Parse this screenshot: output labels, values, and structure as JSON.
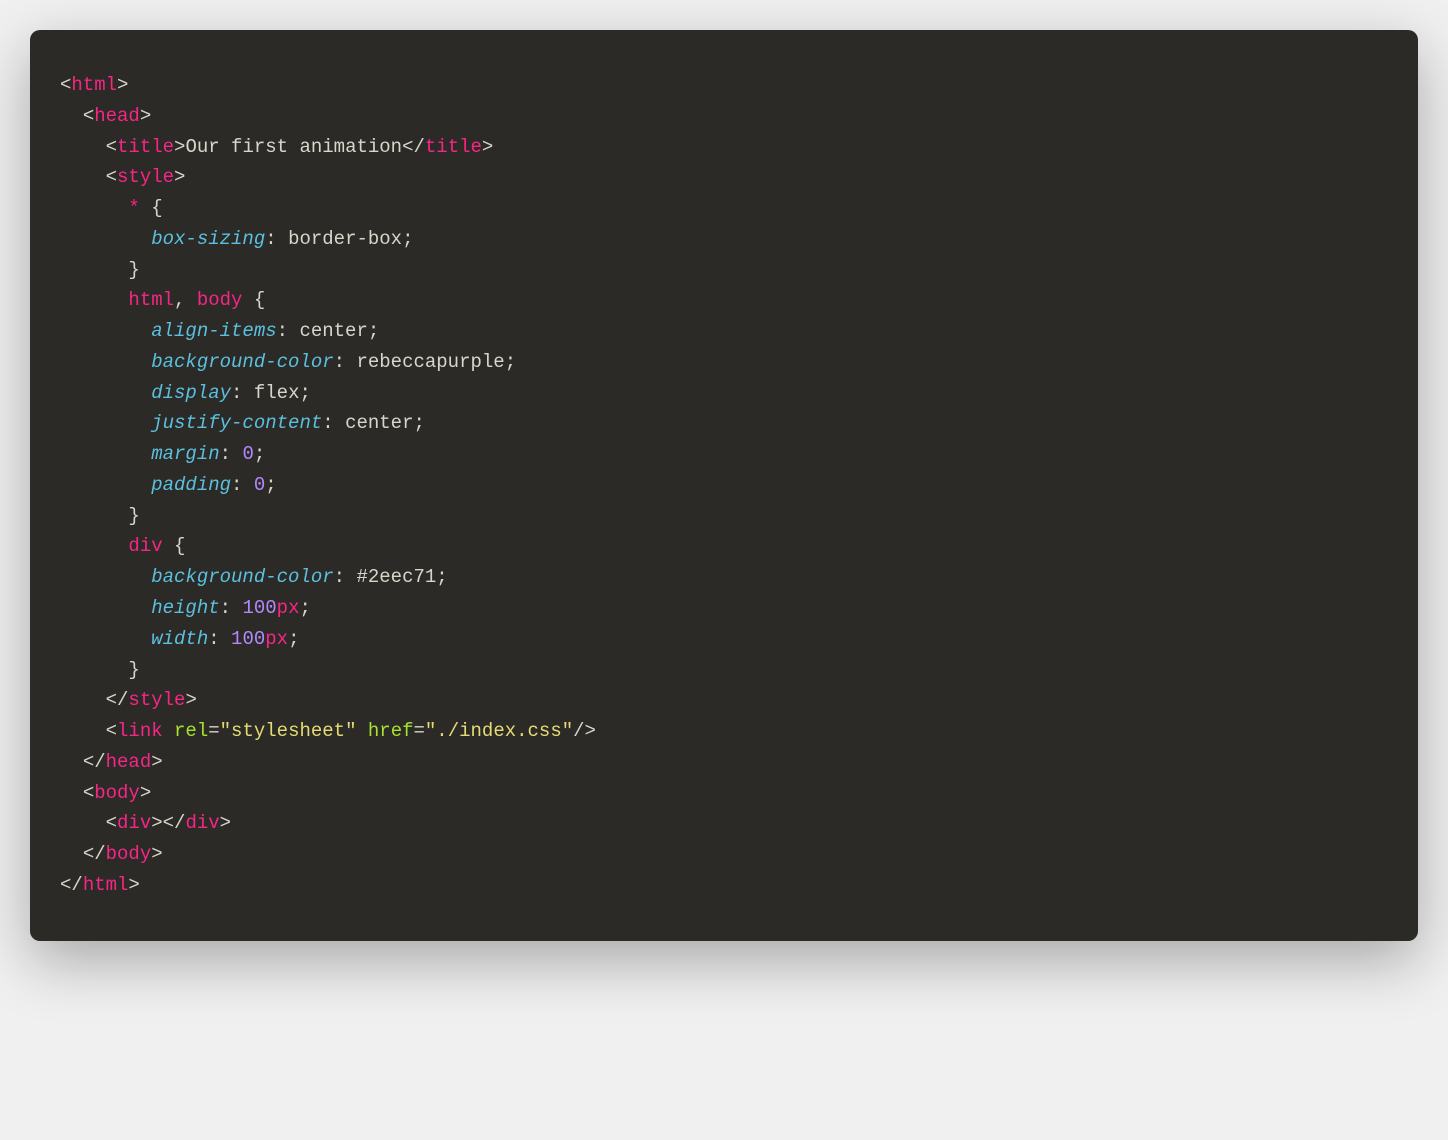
{
  "tokens": {
    "html": "html",
    "head": "head",
    "title": "title",
    "style": "style",
    "link": "link",
    "body": "body",
    "div": "div",
    "titleText": "Our first animation",
    "star": "*",
    "boxSizing": "box-sizing",
    "borderBox": "border-box",
    "htmlSel": "html",
    "bodySel": "body",
    "alignItems": "align-items",
    "center": "center",
    "backgroundColor": "background-color",
    "rebeccapurple": "rebeccapurple",
    "display": "display",
    "flex": "flex",
    "justifyContent": "justify-content",
    "margin": "margin",
    "zero": "0",
    "padding": "padding",
    "divSel": "div",
    "hexColor": "#2eec71",
    "height": "height",
    "hundred": "100",
    "px": "px",
    "width": "width",
    "rel": "rel",
    "relVal": "\"stylesheet\"",
    "href": "href",
    "hrefVal": "\"./index.css\""
  }
}
